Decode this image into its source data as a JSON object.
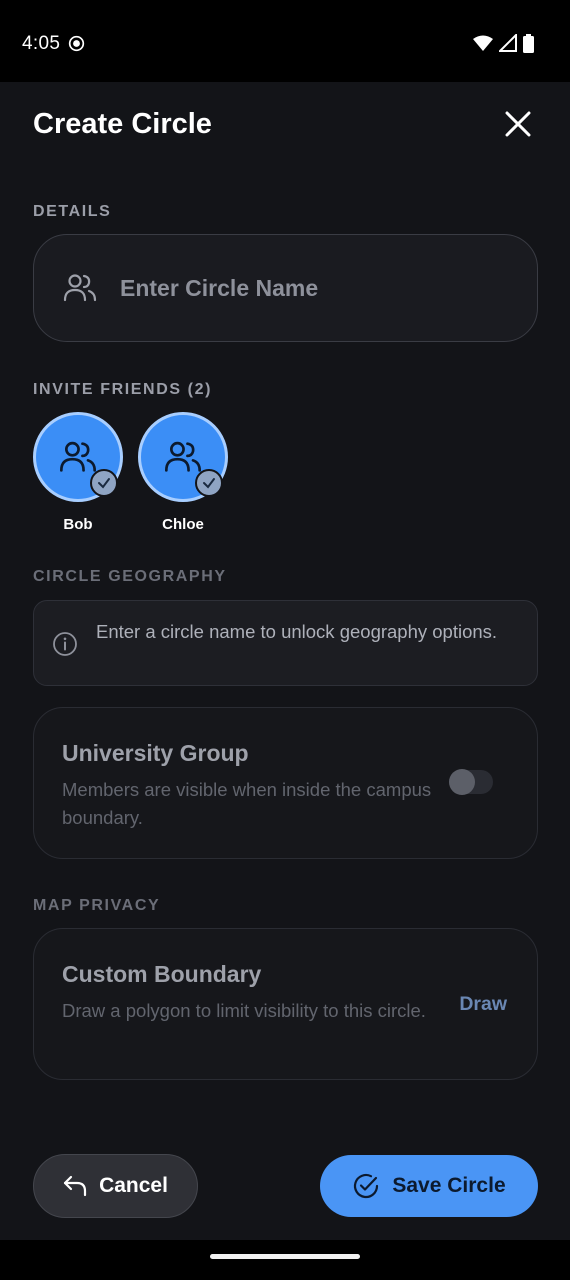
{
  "status_bar": {
    "time": "4:05"
  },
  "header": {
    "title": "Create Circle"
  },
  "details": {
    "label": "DETAILS",
    "name_placeholder": "Enter Circle Name",
    "name_value": ""
  },
  "invite": {
    "label": "INVITE FRIENDS (2)",
    "friends": [
      {
        "name": "Bob",
        "selected": true
      },
      {
        "name": "Chloe",
        "selected": true
      }
    ]
  },
  "geography": {
    "label": "CIRCLE GEOGRAPHY",
    "info_text": "Enter a circle name to unlock geography options.",
    "university": {
      "title": "University Group",
      "description": "Members are visible when inside the campus boundary.",
      "enabled": false
    }
  },
  "privacy": {
    "label": "MAP PRIVACY",
    "boundary": {
      "title": "Custom Boundary",
      "description": "Draw a polygon to limit visibility to this circle.",
      "action": "Draw"
    }
  },
  "footer": {
    "cancel_label": "Cancel",
    "save_label": "Save Circle"
  },
  "colors": {
    "accent": "#4a95f5",
    "avatar": "#3b8ef6",
    "background": "#131418"
  }
}
